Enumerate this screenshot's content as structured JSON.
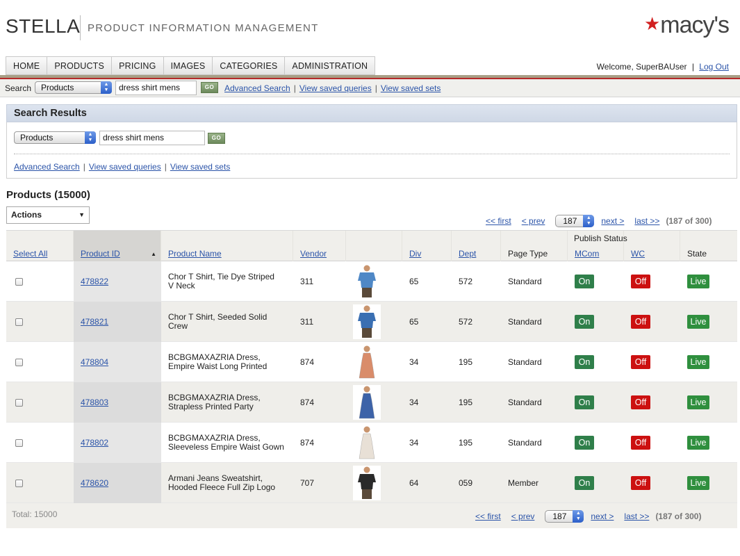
{
  "header": {
    "brand": "STELLA",
    "subtitle": "PRODUCT INFORMATION MANAGEMENT",
    "logo_text": "macy's",
    "logo_star": "★"
  },
  "nav": {
    "tabs": [
      "HOME",
      "PRODUCTS",
      "PRICING",
      "IMAGES",
      "CATEGORIES",
      "ADMINISTRATION"
    ],
    "welcome": "Welcome, SuperBAUser",
    "separator": "|",
    "logout": "Log Out"
  },
  "searchbar": {
    "label": "Search",
    "scope": "Products",
    "query": "dress shirt mens",
    "go": "GO",
    "links": [
      "Advanced Search",
      "View saved queries",
      "View saved sets"
    ]
  },
  "search_results": {
    "title": "Search Results",
    "scope": "Products",
    "query": "dress shirt mens",
    "go": "GO",
    "links": [
      "Advanced Search",
      "View saved queries",
      "View saved sets"
    ]
  },
  "products": {
    "title": "Products (15000)",
    "actions_label": "Actions",
    "total": "Total: 15000"
  },
  "pager": {
    "first": "<< first",
    "prev": "< prev",
    "page": "187",
    "next": "next >",
    "last": "last >>",
    "count": "(187 of 300)"
  },
  "table": {
    "headers": {
      "select_all": "Select All",
      "product_id": "Product ID",
      "product_name": "Product Name",
      "vendor": "Vendor",
      "div": "Div",
      "dept": "Dept",
      "page_type": "Page Type",
      "publish_status": "Publish Status",
      "mcom": "MCom",
      "wc": "WC",
      "state": "State"
    },
    "rows": [
      {
        "id": "478822",
        "name": "Chor T Shirt, Tie Dye Striped\nV Neck",
        "vendor": "311",
        "div": "65",
        "dept": "572",
        "page_type": "Standard",
        "mcom": "On",
        "wc": "Off",
        "state": "Live",
        "thumb": "blue-tshirt-man",
        "color": "#4f88c6"
      },
      {
        "id": "478821",
        "name": "Chor T Shirt, Seeded Solid\nCrew",
        "vendor": "311",
        "div": "65",
        "dept": "572",
        "page_type": "Standard",
        "mcom": "On",
        "wc": "Off",
        "state": "Live",
        "thumb": "blue-crew-man",
        "color": "#3a6fb2"
      },
      {
        "id": "478804",
        "name": "BCBGMAXAZRIA Dress,\nEmpire Waist Long Printed",
        "vendor": "874",
        "div": "34",
        "dept": "195",
        "page_type": "Standard",
        "mcom": "On",
        "wc": "Off",
        "state": "Live",
        "thumb": "long-printed-dress",
        "color": "#d98c6a"
      },
      {
        "id": "478803",
        "name": "BCBGMAXAZRIA Dress,\nStrapless Printed Party",
        "vendor": "874",
        "div": "34",
        "dept": "195",
        "page_type": "Standard",
        "mcom": "On",
        "wc": "Off",
        "state": "Live",
        "thumb": "strapless-party-dress",
        "color": "#3d63a8"
      },
      {
        "id": "478802",
        "name": "BCBGMAXAZRIA Dress,\nSleeveless Empire Waist Gown",
        "vendor": "874",
        "div": "34",
        "dept": "195",
        "page_type": "Standard",
        "mcom": "On",
        "wc": "Off",
        "state": "Live",
        "thumb": "white-gown",
        "color": "#e8e0d6"
      },
      {
        "id": "478620",
        "name": "Armani Jeans Sweatshirt,\nHooded Fleece Full Zip Logo",
        "vendor": "707",
        "div": "64",
        "dept": "059",
        "page_type": "Member",
        "mcom": "On",
        "wc": "Off",
        "state": "Live",
        "thumb": "black-hoodie-man",
        "color": "#2a2a2a"
      }
    ]
  }
}
